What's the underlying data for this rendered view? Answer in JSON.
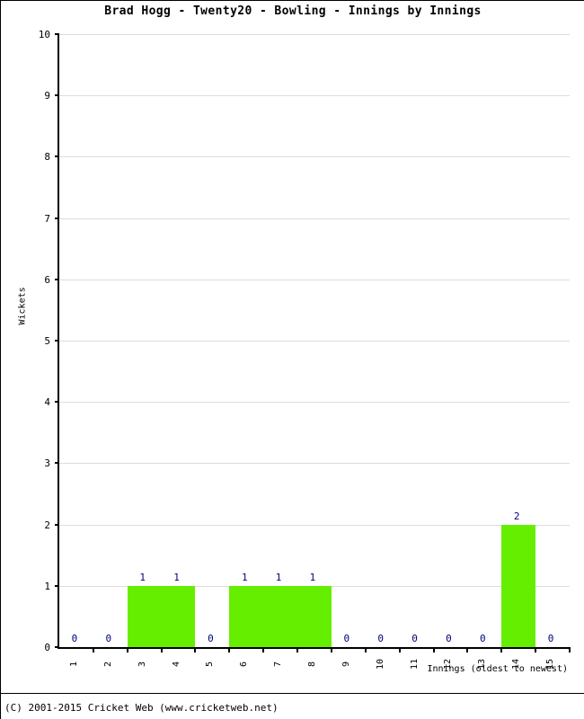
{
  "chart_data": {
    "type": "bar",
    "title": "Brad Hogg - Twenty20 - Bowling - Innings by Innings",
    "xlabel": "Innings (oldest to newest)",
    "ylabel": "Wickets",
    "categories": [
      "1",
      "2",
      "3",
      "4",
      "5",
      "6",
      "7",
      "8",
      "9",
      "10",
      "11",
      "12",
      "13",
      "14",
      "15"
    ],
    "values": [
      0,
      0,
      1,
      1,
      0,
      1,
      1,
      1,
      0,
      0,
      0,
      0,
      0,
      2,
      0
    ],
    "point_labels": [
      "0",
      "0",
      "1",
      "1",
      "0",
      "1",
      "1",
      "1",
      "0",
      "0",
      "0",
      "0",
      "0",
      "2",
      "0"
    ],
    "ylim": [
      0,
      10
    ],
    "yticks": [
      0,
      1,
      2,
      3,
      4,
      5,
      6,
      7,
      8,
      9,
      10
    ],
    "ytick_labels": [
      "0",
      "1",
      "2",
      "3",
      "4",
      "5",
      "6",
      "7",
      "8",
      "9",
      "10"
    ],
    "grid": true,
    "legend": false,
    "bar_color": "#66EE00",
    "label_color": "#000080",
    "grid_color": "#DCDCDC",
    "axis_color": "#000000"
  },
  "footer": {
    "copyright": "(C) 2001-2015 Cricket Web (www.cricketweb.net)"
  }
}
